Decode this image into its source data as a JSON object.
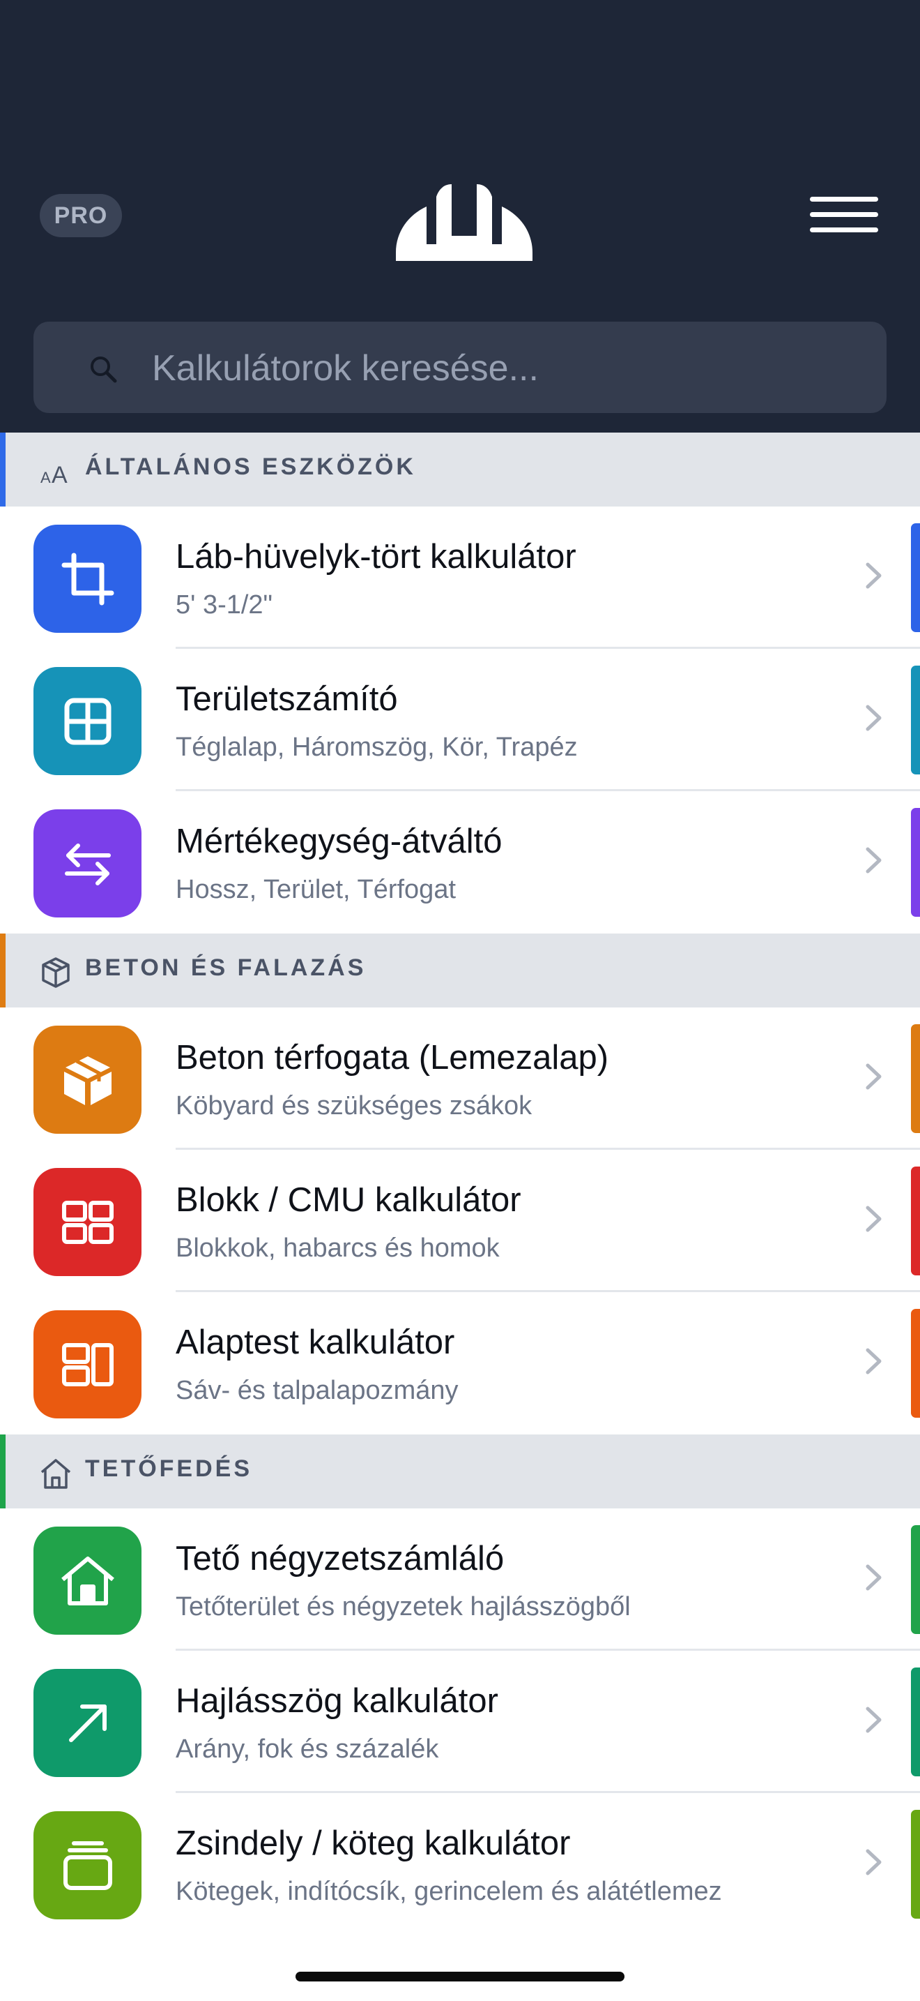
{
  "header": {
    "pro_label": "PRO",
    "search_placeholder": "Kalkulátorok keresése...",
    "background": "#1e2637"
  },
  "sections": [
    {
      "title": "ÁLTALÁNOS ESZKÖZÖK",
      "icon": "text-size-icon",
      "accent": "#2f6ae8",
      "items": [
        {
          "title": "Láb-hüvelyk-tört kalkulátor",
          "subtitle": "5' 3-1/2\"",
          "icon": "crop-icon",
          "color": "#2d63e8"
        },
        {
          "title": "Területszámító",
          "subtitle": "Téglalap, Háromszög, Kör, Trapéz",
          "icon": "grid-square-icon",
          "color": "#1693b8"
        },
        {
          "title": "Mértékegység-átváltó",
          "subtitle": "Hossz, Terület, Térfogat",
          "icon": "swap-arrows-icon",
          "color": "#7b3fea"
        }
      ]
    },
    {
      "title": "BETON ÉS FALAZÁS",
      "icon": "cube-outline-icon",
      "accent": "#de7c12",
      "items": [
        {
          "title": "Beton térfogata (Lemezalap)",
          "subtitle": "Köbyard és szükséges zsákok",
          "icon": "box-icon",
          "color": "#dd7b12"
        },
        {
          "title": "Blokk / CMU kalkulátor",
          "subtitle": "Blokkok, habarcs és homok",
          "icon": "blocks-icon",
          "color": "#dc2828"
        },
        {
          "title": "Alaptest kalkulátor",
          "subtitle": "Sáv- és talpalapozmány",
          "icon": "footing-icon",
          "color": "#ea5a10"
        }
      ]
    },
    {
      "title": "TETŐFEDÉS",
      "icon": "house-outline-icon",
      "accent": "#1ea44a",
      "items": [
        {
          "title": "Tető négyzetszámláló",
          "subtitle": "Tetőterület és négyzetek hajlásszögből",
          "icon": "house-icon",
          "color": "#21a34a"
        },
        {
          "title": "Hajlásszög kalkulátor",
          "subtitle": "Arány, fok és százalék",
          "icon": "arrow-up-right-icon",
          "color": "#0f9a6a"
        },
        {
          "title": "Zsindely / köteg kalkulátor",
          "subtitle": "Kötegek, indítócsík, gerincelem és alátétlemez",
          "icon": "stack-icon",
          "color": "#67a813"
        }
      ]
    }
  ]
}
